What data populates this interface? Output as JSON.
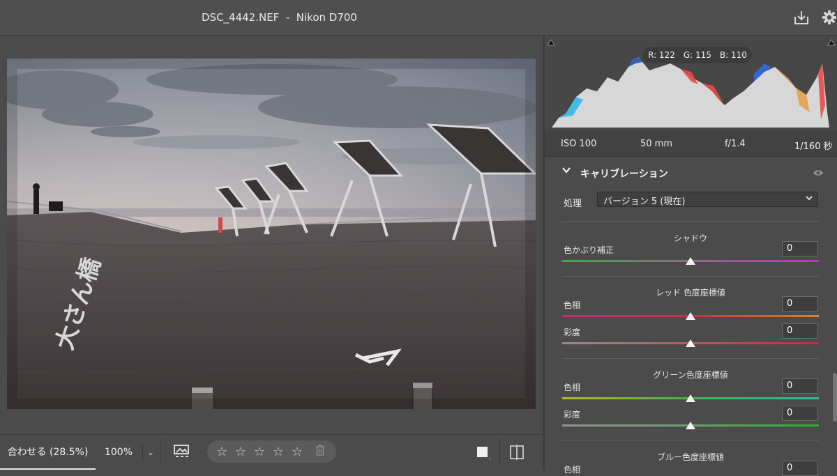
{
  "header": {
    "title": "DSC_4442.NEF  -  Nikon D700",
    "icons": [
      "download-icon",
      "gear-icon"
    ]
  },
  "toolbar": {
    "zoom_fit": "合わせる (28.5%)",
    "zoom_100": "100%",
    "zoom_dropdown": "⌄",
    "stars": [
      "☆",
      "☆",
      "☆",
      "☆",
      "☆"
    ],
    "rating_value": 0
  },
  "histogram": {
    "r": "R: 122",
    "g": "G: 115",
    "b": "B: 110"
  },
  "exif": {
    "iso": "ISO 100",
    "focal": "50 mm",
    "aperture": "f/1.4",
    "shutter": "1/160 秒"
  },
  "calibration": {
    "title": "キャリブレーション",
    "process_label": "処理",
    "process_value": "バージョン 5 (現在)",
    "shadow_title": "シャドウ",
    "tint_label": "色かぶり補正",
    "tint_value": "0",
    "red_title": "レッド 色度座標値",
    "red_hue_label": "色相",
    "red_hue_value": "0",
    "red_sat_label": "彩度",
    "red_sat_value": "0",
    "green_title": "グリーン色度座標値",
    "green_hue_label": "色相",
    "green_hue_value": "0",
    "green_sat_label": "彩度",
    "green_sat_value": "0",
    "blue_title": "ブルー色度座標値",
    "blue_hue_label": "色相",
    "blue_hue_value": "0"
  },
  "colors": {
    "accent": "#f2f2f2",
    "panel": "#4b4b4b"
  }
}
